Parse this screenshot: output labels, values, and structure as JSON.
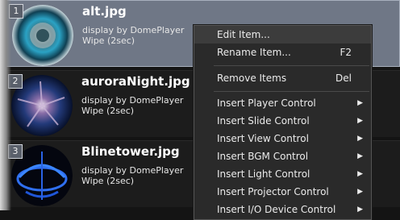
{
  "playlist": {
    "items": [
      {
        "number": "1",
        "title": "alt.jpg",
        "line1": "display by DomePlayer",
        "line2": "Wipe (2sec)"
      },
      {
        "number": "2",
        "title": "auroraNight.jpg",
        "line1": "display by DomePlayer",
        "line2": "Wipe (2sec)"
      },
      {
        "number": "3",
        "title": "Blinetower.jpg",
        "line1": "display by DomePlayer",
        "line2": "Wipe (2sec)"
      }
    ]
  },
  "context_menu": {
    "items": [
      {
        "label": "Edit Item...",
        "shortcut": ""
      },
      {
        "label": "Rename Item...",
        "shortcut": "F2"
      },
      {
        "label": "Remove Items",
        "shortcut": "Del"
      },
      {
        "label": "Insert Player Control"
      },
      {
        "label": "Insert Slide Control"
      },
      {
        "label": "Insert View Control"
      },
      {
        "label": "Insert BGM Control"
      },
      {
        "label": "Insert Light Control"
      },
      {
        "label": "Insert Projector Control"
      },
      {
        "label": "Insert I/O Device Control"
      }
    ],
    "submenu_arrow": "▶"
  },
  "icons": {
    "submenu": "chevron-right-icon"
  }
}
